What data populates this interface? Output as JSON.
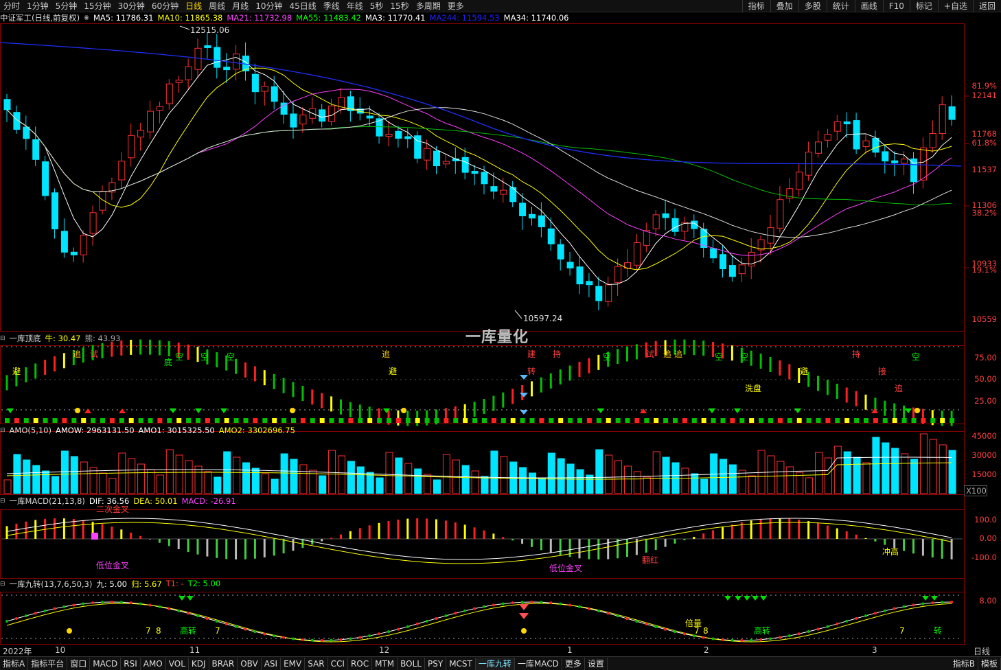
{
  "timeframe_tabs": [
    "分时",
    "1分钟",
    "5分钟",
    "15分钟",
    "30分钟",
    "60分钟",
    "日线",
    "周线",
    "月线",
    "10分钟",
    "45日线",
    "季线",
    "年线",
    "5秒",
    "15秒",
    "多周期",
    "更多"
  ],
  "active_timeframe": "日线",
  "right_tools": [
    "指标",
    "叠加",
    "多股",
    "统计",
    "画线",
    "F10",
    "标记",
    "+自选",
    "返回"
  ],
  "main": {
    "title": "中证军工(日线,前复权)",
    "ma": [
      {
        "label": "MA5: 11786.31",
        "color": "#ffffff"
      },
      {
        "label": "MA10: 11865.38",
        "color": "#ffff00"
      },
      {
        "label": "MA21: 11732.98",
        "color": "#ff40ff"
      },
      {
        "label": "MA55: 11483.42",
        "color": "#00ff00"
      },
      {
        "label": "MA3: 11770.41",
        "color": "#ffffff"
      },
      {
        "label": "MA244: 11594.53",
        "color": "#2020ff"
      },
      {
        "label": "MA34: 11740.06",
        "color": "#ffffff"
      }
    ],
    "high_label": "12515.06",
    "low_label": "10597.24",
    "price_axis": [
      {
        "v": "12141",
        "c": "#ff4040"
      },
      {
        "v": "81.9%",
        "c": "#ff4040"
      },
      {
        "v": "11768",
        "c": "#ff4040"
      },
      {
        "v": "61.8%",
        "c": "#ff4040"
      },
      {
        "v": "11537",
        "c": "#ff4040"
      },
      {
        "v": "11306",
        "c": "#ff4040"
      },
      {
        "v": "38.2%",
        "c": "#ff4040"
      },
      {
        "v": "10933",
        "c": "#ff4040"
      },
      {
        "v": "19.1%",
        "c": "#ff4040"
      },
      {
        "v": "10559",
        "c": "#ff4040"
      }
    ],
    "watermark": "一库量化"
  },
  "p1": {
    "title": "一库顶底",
    "vals": [
      {
        "label": "牛: 30.47",
        "color": "#ffff00"
      },
      {
        "label": "熊: 43.93",
        "color": "#aaaaaa"
      }
    ],
    "axis": [
      "75.00",
      "50.00",
      "25.00"
    ],
    "signals": [
      {
        "t": "避",
        "c": "#ffff00"
      },
      {
        "t": "追",
        "c": "#ffcc00"
      },
      {
        "t": "试",
        "c": "#ff4040"
      },
      {
        "t": "空",
        "c": "#00ff00"
      },
      {
        "t": "空",
        "c": "#00ff00"
      },
      {
        "t": "空",
        "c": "#00ff00"
      },
      {
        "t": "追",
        "c": "#ffcc00"
      },
      {
        "t": "避",
        "c": "#ffff00"
      },
      {
        "t": "建",
        "c": "#ff4040"
      },
      {
        "t": "持",
        "c": "#ff4040"
      },
      {
        "t": "转",
        "c": "#ff4040"
      },
      {
        "t": "空",
        "c": "#00ff00"
      },
      {
        "t": "试",
        "c": "#ff4040"
      },
      {
        "t": "追",
        "c": "#ffcc00"
      },
      {
        "t": "追",
        "c": "#ffcc00"
      },
      {
        "t": "空",
        "c": "#00ff00"
      },
      {
        "t": "空",
        "c": "#00ff00"
      },
      {
        "t": "洗盘",
        "c": "#ffff00"
      },
      {
        "t": "避",
        "c": "#ffff00"
      },
      {
        "t": "持",
        "c": "#ff4040"
      },
      {
        "t": "接",
        "c": "#ff4040"
      },
      {
        "t": "追",
        "c": "#ff4040"
      },
      {
        "t": "空",
        "c": "#00ff00"
      },
      {
        "t": "底",
        "c": "#00ff00"
      }
    ]
  },
  "p2": {
    "title": "AMO(5,10)",
    "vals": [
      {
        "label": "AMOW: 2963131.50",
        "color": "#ffffff"
      },
      {
        "label": "AMO1: 3015325.50",
        "color": "#ffffff"
      },
      {
        "label": "AMO2: 3302696.75",
        "color": "#ffff00"
      }
    ],
    "axis": [
      "45000",
      "30000",
      "15000"
    ],
    "unit": "X100"
  },
  "p3": {
    "title": "一库MACD(21,13,8)",
    "vals": [
      {
        "label": "DIF: 36.56",
        "color": "#ffffff"
      },
      {
        "label": "DEA: 50.01",
        "color": "#ffff00"
      },
      {
        "label": "MACD: -26.91",
        "color": "#ff40ff"
      }
    ],
    "axis": [
      "100.0",
      "0.00",
      "-100.0"
    ],
    "notes": [
      {
        "t": "二次金叉",
        "c": "#ff4040"
      },
      {
        "t": "低位金叉",
        "c": "#ff40ff"
      },
      {
        "t": "低位金叉",
        "c": "#ff40ff"
      },
      {
        "t": "翻红",
        "c": "#ff4040"
      },
      {
        "t": "冲高",
        "c": "#ffff00"
      }
    ]
  },
  "p4": {
    "title": "一库九转(13,7,6,50,3)",
    "vals": [
      {
        "label": "九: 5.00",
        "color": "#ffffff"
      },
      {
        "label": "归: 5.67",
        "color": "#ffff00"
      },
      {
        "label": "T1: -",
        "color": "#ff4040"
      },
      {
        "label": "T2: 5.00",
        "color": "#00ff00"
      }
    ],
    "axis": [
      "8.00"
    ],
    "notes": [
      {
        "t": "7",
        "c": "#ffff00"
      },
      {
        "t": "8",
        "c": "#ffff00"
      },
      {
        "t": "高转",
        "c": "#00ff00"
      },
      {
        "t": "7",
        "c": "#ffff00"
      },
      {
        "t": "倍量",
        "c": "#ffff00"
      },
      {
        "t": "7",
        "c": "#ffff00"
      },
      {
        "t": "8",
        "c": "#ffff00"
      },
      {
        "t": "高转",
        "c": "#00ff00"
      },
      {
        "t": "7",
        "c": "#ffff00"
      },
      {
        "t": "转",
        "c": "#00ff00"
      }
    ]
  },
  "x_labels": [
    "2022年",
    "10",
    "11",
    "12",
    "1",
    "2",
    "3"
  ],
  "bottom_tabs": [
    "指标A",
    "指标平台",
    "窗口",
    "MACD",
    "RSI",
    "AMO",
    "VOL",
    "KDJ",
    "BRAR",
    "OBV",
    "ASI",
    "EMV",
    "SAR",
    "CCI",
    "ROC",
    "MTM",
    "BOLL",
    "PSY",
    "MCST",
    "一库九转",
    "一库MACD",
    "更多",
    "设置"
  ],
  "bottom_right": [
    "指标B",
    "模板"
  ],
  "period_label": "日线"
}
